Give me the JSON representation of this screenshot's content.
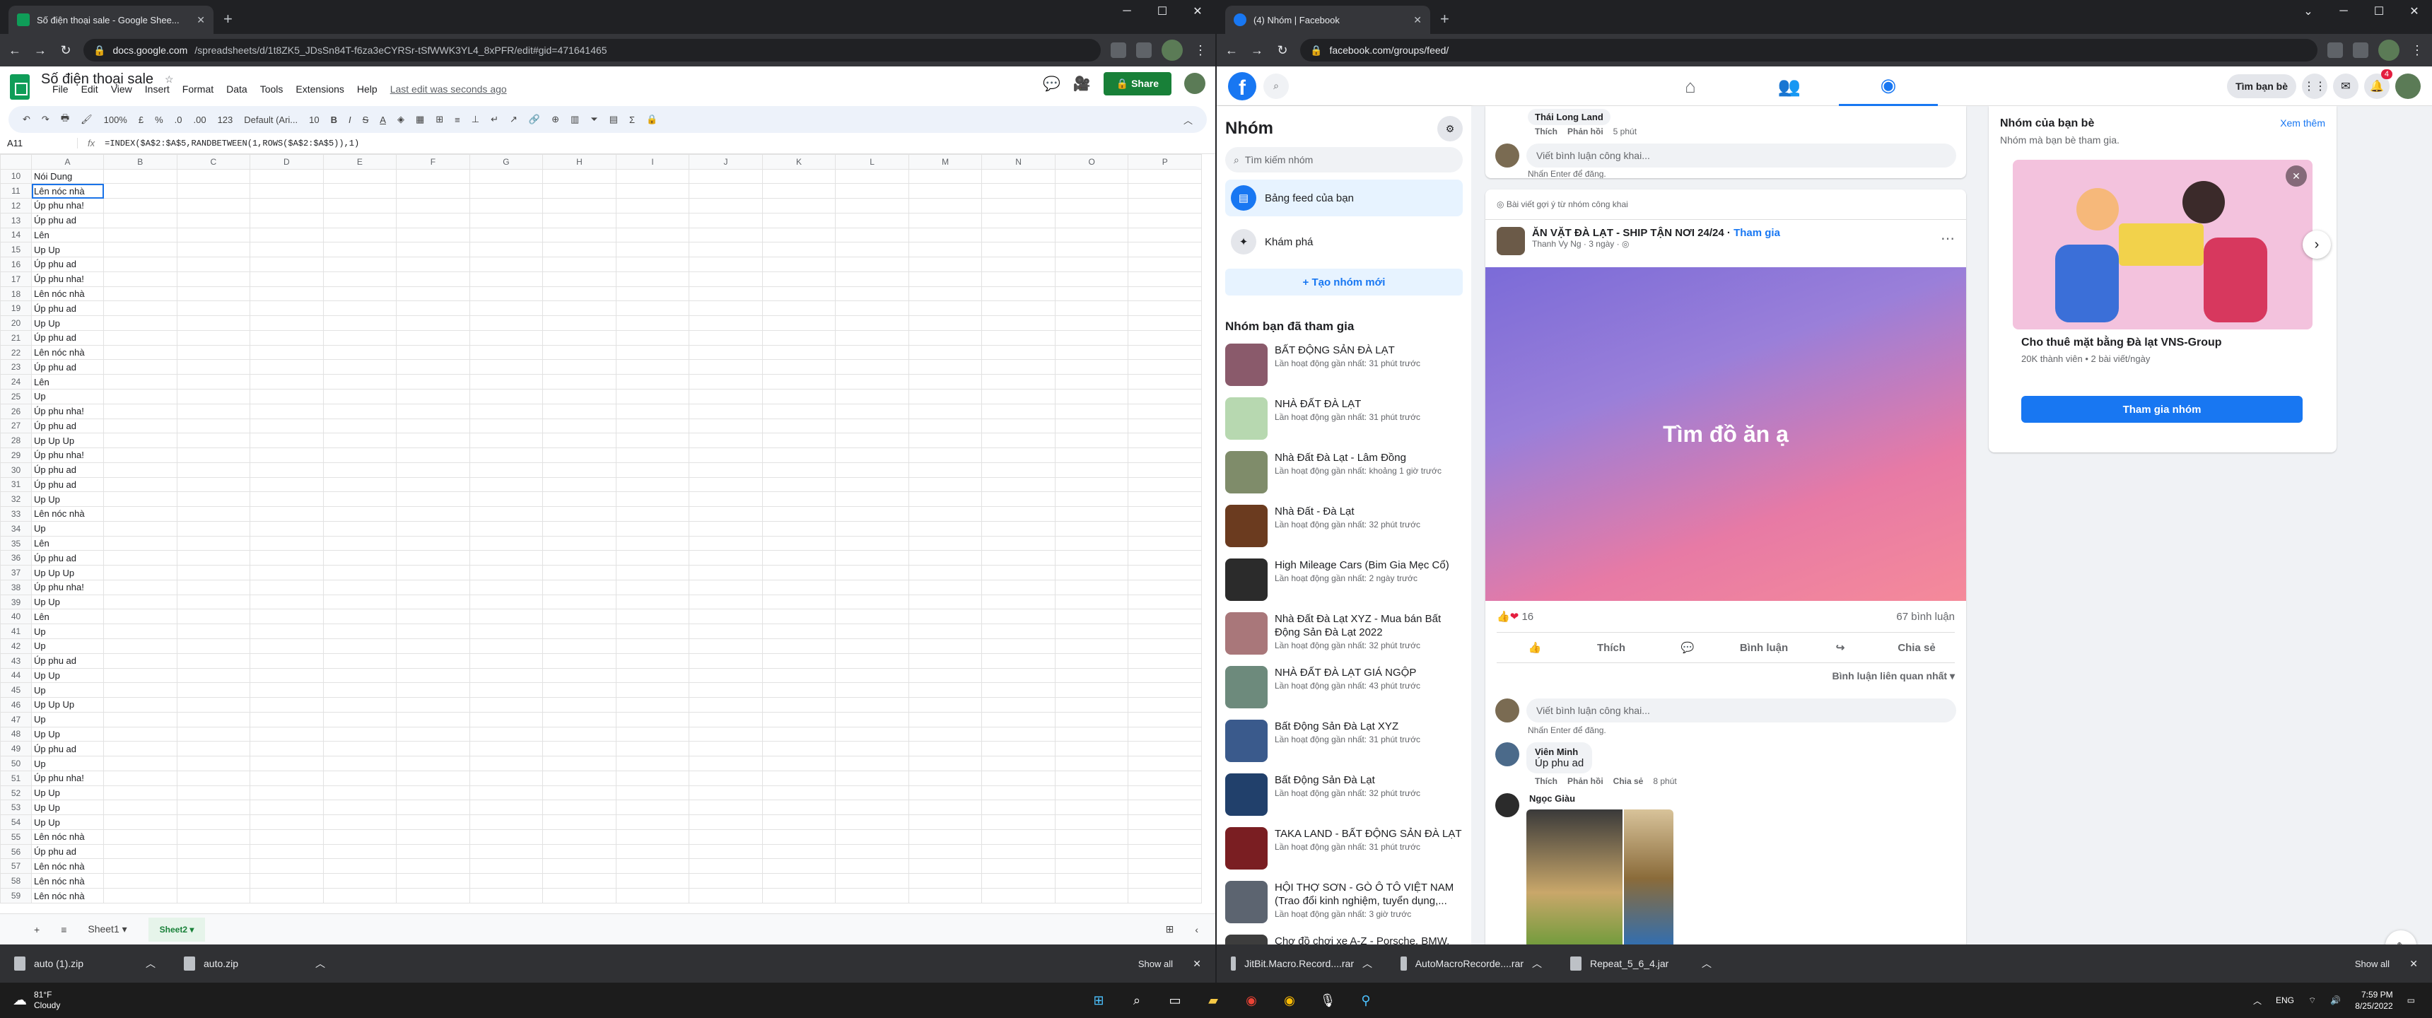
{
  "left_browser": {
    "tab_title": "Số điện thoại sale - Google Shee...",
    "url_host": "docs.google.com",
    "url_path": "/spreadsheets/d/1t8ZK5_JDsSn84T-f6za3eCYRSr-tSfWWK3YL4_8xPFR/edit#gid=471641465"
  },
  "sheets": {
    "doc_title": "Số điện thoại sale",
    "menu": [
      "File",
      "Edit",
      "View",
      "Insert",
      "Format",
      "Data",
      "Tools",
      "Extensions",
      "Help"
    ],
    "last_edit": "Last edit was seconds ago",
    "share_label": "Share",
    "toolbar": {
      "zoom": "100%",
      "currency": "£",
      "percent": "%",
      "dec0": ".0",
      "dec00": ".00",
      "fmt": "123",
      "font": "Default (Ari...",
      "size": "10"
    },
    "name_box": "A11",
    "formula": "=INDEX($A$2:$A$5,RANDBETWEEN(1,ROWS($A$2:$A$5)),1)",
    "columns": [
      "A",
      "B",
      "C",
      "D",
      "E",
      "F",
      "G",
      "H",
      "I",
      "J",
      "K",
      "L",
      "M",
      "N",
      "O",
      "P"
    ],
    "rows": [
      {
        "n": "10",
        "v": "Nói Dung"
      },
      {
        "n": "11",
        "v": "Lên nóc nhà"
      },
      {
        "n": "12",
        "v": "Úp phu nha!"
      },
      {
        "n": "13",
        "v": "Úp phu ad"
      },
      {
        "n": "14",
        "v": "Lên"
      },
      {
        "n": "15",
        "v": "Up Up"
      },
      {
        "n": "16",
        "v": "Úp phu ad"
      },
      {
        "n": "17",
        "v": "Úp phu nha!"
      },
      {
        "n": "18",
        "v": "Lên nóc nhà"
      },
      {
        "n": "19",
        "v": "Úp phu ad"
      },
      {
        "n": "20",
        "v": "Up Up"
      },
      {
        "n": "21",
        "v": "Úp phu ad"
      },
      {
        "n": "22",
        "v": "Lên nóc nhà"
      },
      {
        "n": "23",
        "v": "Úp phu ad"
      },
      {
        "n": "24",
        "v": "Lên"
      },
      {
        "n": "25",
        "v": "Up"
      },
      {
        "n": "26",
        "v": "Úp phu nha!"
      },
      {
        "n": "27",
        "v": "Úp phu ad"
      },
      {
        "n": "28",
        "v": "Up Up Up"
      },
      {
        "n": "29",
        "v": "Úp phu nha!"
      },
      {
        "n": "30",
        "v": "Úp phu ad"
      },
      {
        "n": "31",
        "v": "Úp phu ad"
      },
      {
        "n": "32",
        "v": "Up Up"
      },
      {
        "n": "33",
        "v": "Lên nóc nhà"
      },
      {
        "n": "34",
        "v": "Up"
      },
      {
        "n": "35",
        "v": "Lên"
      },
      {
        "n": "36",
        "v": "Úp phu ad"
      },
      {
        "n": "37",
        "v": "Up Up Up"
      },
      {
        "n": "38",
        "v": "Úp phu nha!"
      },
      {
        "n": "39",
        "v": "Up Up"
      },
      {
        "n": "40",
        "v": "Lên"
      },
      {
        "n": "41",
        "v": "Up"
      },
      {
        "n": "42",
        "v": "Up"
      },
      {
        "n": "43",
        "v": "Úp phu ad"
      },
      {
        "n": "44",
        "v": "Up Up"
      },
      {
        "n": "45",
        "v": "Up"
      },
      {
        "n": "46",
        "v": "Up Up Up"
      },
      {
        "n": "47",
        "v": "Up"
      },
      {
        "n": "48",
        "v": "Up Up"
      },
      {
        "n": "49",
        "v": "Úp phu ad"
      },
      {
        "n": "50",
        "v": "Up"
      },
      {
        "n": "51",
        "v": "Úp phu nha!"
      },
      {
        "n": "52",
        "v": "Up Up"
      },
      {
        "n": "53",
        "v": "Up Up"
      },
      {
        "n": "54",
        "v": "Up Up"
      },
      {
        "n": "55",
        "v": "Lên nóc nhà"
      },
      {
        "n": "56",
        "v": "Úp phu ad"
      },
      {
        "n": "57",
        "v": "Lên nóc nhà"
      },
      {
        "n": "58",
        "v": "Lên nóc nhà"
      },
      {
        "n": "59",
        "v": "Lên nóc nhà"
      }
    ],
    "sheet_tabs": [
      "Sheet1",
      "Sheet2"
    ],
    "active_sheet": "Sheet2"
  },
  "right_browser": {
    "tab_title": "(4) Nhóm | Facebook",
    "url": "facebook.com/groups/feed/"
  },
  "facebook": {
    "find_friends": "Tìm bạn bè",
    "notif_count": "4",
    "sidebar_title": "Nhóm",
    "search_placeholder": "Tìm kiếm nhóm",
    "nav_feed": "Bảng feed của bạn",
    "nav_discover": "Khám phá",
    "new_group": "+ Tạo nhóm mới",
    "joined_title": "Nhóm bạn đã tham gia",
    "groups": [
      {
        "name": "BẤT ĐỘNG SẢN ĐÀ LẠT",
        "time": "Lần hoạt động gần nhất: 31 phút trước",
        "color": "#8a5a6b"
      },
      {
        "name": "NHÀ ĐẤT ĐÀ LẠT",
        "time": "Lần hoạt động gần nhất: 31 phút trước",
        "color": "#b7d8b0"
      },
      {
        "name": "Nhà Đất Đà Lạt - Lâm Đồng",
        "time": "Lần hoạt động gần nhất: khoảng 1 giờ trước",
        "color": "#7f8c6a"
      },
      {
        "name": "Nhà Đất - Đà Lạt",
        "time": "Lần hoạt động gần nhất: 32 phút trước",
        "color": "#6b3b1f"
      },
      {
        "name": "High Mileage Cars (Bim Gia Mẹc Cổ)",
        "time": "Lần hoạt động gần nhất: 2 ngày trước",
        "color": "#2b2b2b"
      },
      {
        "name": "Nhà Đất Đà Lạt XYZ - Mua bán Bất Động Sản Đà Lạt 2022",
        "time": "Lần hoạt động gần nhất: 32 phút trước",
        "color": "#a9777a"
      },
      {
        "name": "NHÀ ĐẤT ĐÀ LẠT GIÁ NGỘP",
        "time": "Lần hoạt động gần nhất: 43 phút trước",
        "color": "#6d8a7c"
      },
      {
        "name": "Bất Động Sản Đà Lạt XYZ",
        "time": "Lần hoạt động gần nhất: 31 phút trước",
        "color": "#3a5a8c"
      },
      {
        "name": "Bất Động Sản Đà Lạt",
        "time": "Lần hoạt động gần nhất: 32 phút trước",
        "color": "#21406b"
      },
      {
        "name": "TAKA LAND - BẤT ĐỘNG SẢN ĐÀ LẠT",
        "time": "Lần hoạt động gần nhất: 31 phút trước",
        "color": "#7a1e22"
      },
      {
        "name": "HỘI THỢ SƠN - GÒ Ô TÔ VIỆT NAM (Trao đổi kinh nghiệm, tuyển dụng,...",
        "time": "Lần hoạt động gần nhất: 3 giờ trước",
        "color": "#5c6470"
      },
      {
        "name": "Chợ đồ chơi xe A-Z - Porsche, BMW, MER, Audi, Ford...",
        "time": "",
        "color": "#3d3d3d"
      }
    ],
    "top_comment": {
      "author": "Thái Long Land",
      "like": "Thích",
      "reply": "Phản hồi",
      "time": "5 phút"
    },
    "comment_placeholder": "Viết bình luận công khai...",
    "enter_hint": "Nhấn Enter để đăng.",
    "suggest_label": "Bài viết gợi ý từ nhóm công khai",
    "post": {
      "group": "ĂN VẶT ĐÀ LẠT - SHIP TẬN NƠI 24/24",
      "join": "Tham gia",
      "author": "Thanh Vy Ng",
      "time": "3 ngày",
      "image_text": "Tìm đồ ăn ạ",
      "reactions": "16",
      "comments": "67 bình luận",
      "like": "Thích",
      "comment": "Bình luận",
      "share": "Chia sẻ",
      "sort": "Bình luận liên quan nhất"
    },
    "comment1": {
      "author": "Viên Minh",
      "text": "Úp phu ad",
      "like": "Thích",
      "reply": "Phản hồi",
      "share": "Chia sẻ",
      "time": "8 phút"
    },
    "comment2": {
      "author": "Ngọc Giàu"
    },
    "friends_groups": {
      "title": "Nhóm của bạn bè",
      "see_all": "Xem thêm",
      "subtitle": "Nhóm mà bạn bè tham gia.",
      "group_name": "Cho thuê mặt bằng Đà lạt VNS-Group",
      "meta": "20K thành viên • 2 bài viết/ngày",
      "join": "Tham gia nhóm"
    }
  },
  "downloads_left": {
    "files": [
      "auto (1).zip",
      "auto.zip"
    ],
    "show_all": "Show all"
  },
  "downloads_right": {
    "files": [
      "JitBit.Macro.Record....rar",
      "AutoMacroRecorde....rar",
      "Repeat_5_6_4.jar"
    ],
    "show_all": "Show all"
  },
  "taskbar": {
    "temp": "81°F",
    "weather": "Cloudy",
    "lang": "ENG",
    "time": "7:59 PM",
    "date": "8/25/2022"
  }
}
